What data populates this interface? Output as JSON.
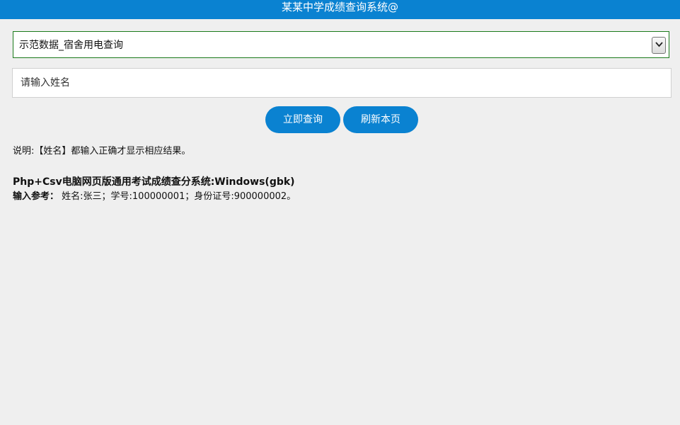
{
  "header": {
    "title": "某某中学成绩查询系统@"
  },
  "form": {
    "dataset_select": {
      "selected": "示范数据_宿舍用电查询"
    },
    "name_input": {
      "placeholder": "请输入姓名",
      "value": ""
    },
    "buttons": {
      "query_label": "立即查询",
      "refresh_label": "刷新本页"
    }
  },
  "info": {
    "note": "说明:【姓名】都输入正确才显示相应结果。",
    "system_title": "Php+Csv电脑网页版通用考试成绩查分系统:Windows(gbk)",
    "reference_label": "输入参考：",
    "reference_text": " 姓名:张三；学号:100000001；身份证号:900000002。"
  },
  "colors": {
    "accent": "#0a82d1",
    "background": "#efefef",
    "select_border": "#1a7a1a"
  },
  "icons": {
    "select_arrow": "chevron-down-icon"
  }
}
